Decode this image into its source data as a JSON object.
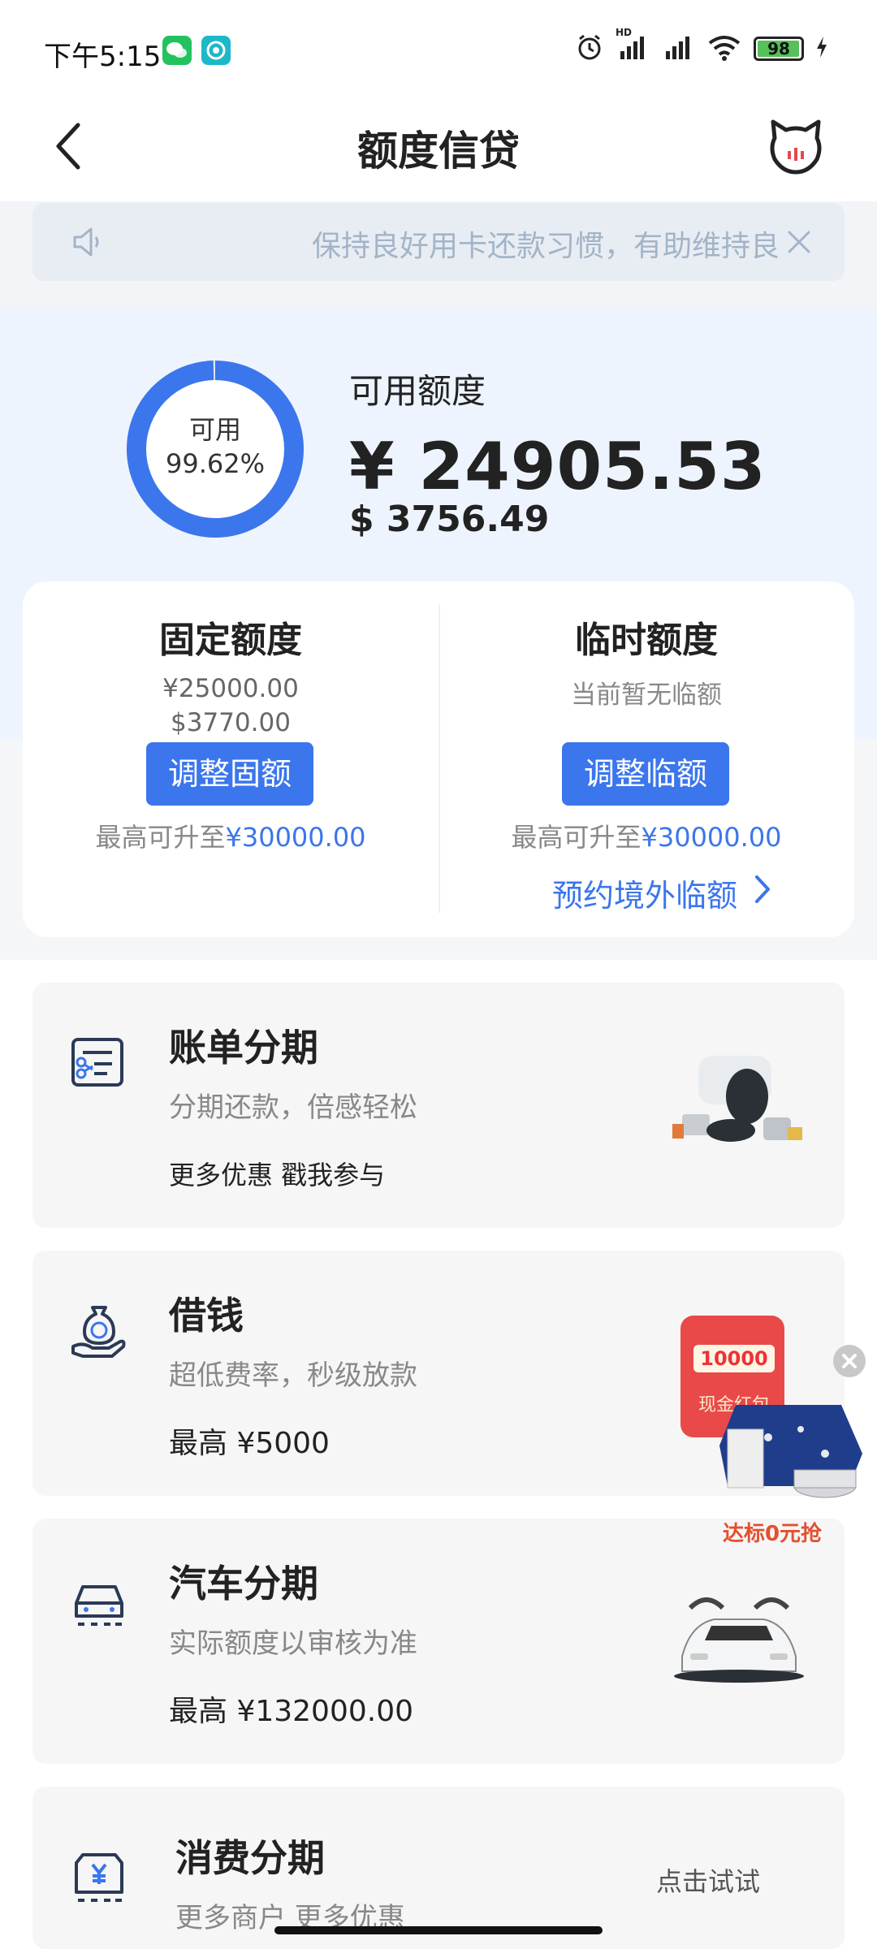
{
  "status_bar": {
    "time": "下午5:15",
    "network_hd": "HD",
    "battery": "98",
    "battery_level": 0.98
  },
  "header": {
    "title": "额度信贷"
  },
  "notice": {
    "text": "保持良好用卡还款习惯，有助维持良"
  },
  "summary": {
    "ring_label": "可用",
    "ring_percent": "99.62%",
    "ring_fraction": 0.9962,
    "title": "可用额度",
    "amount_cny": "¥ 24905.53",
    "amount_usd": "$ 3756.49"
  },
  "fixed": {
    "title": "固定额度",
    "cny": "¥25000.00",
    "usd": "$3770.00",
    "button": "调整固额",
    "max_prefix": "最高可升至",
    "max_value": "¥30000.00"
  },
  "temporary": {
    "title": "临时额度",
    "status": "当前暂无临额",
    "button": "调整临额",
    "max_prefix": "最高可升至",
    "max_value": "¥30000.00",
    "reserve_link": "预约境外临额"
  },
  "features": [
    {
      "title": "账单分期",
      "subtitle": "分期还款，倍感轻松",
      "note": "更多优惠 戳我参与"
    },
    {
      "title": "借钱",
      "subtitle": "超低费率，秒级放款",
      "note": "最高 ¥5000"
    },
    {
      "title": "汽车分期",
      "subtitle": "实际额度以审核为准",
      "note": "最高 ¥132000.00"
    },
    {
      "title": "消费分期",
      "subtitle": "更多商户 更多优惠",
      "action": "点击试试"
    }
  ],
  "promo": {
    "amount": "10000",
    "label": "现金红包",
    "caption": "达标0元抢"
  },
  "colors": {
    "accent": "#3b76ec",
    "summary_bg": "#eef4fe",
    "promo_red": "#e94949"
  }
}
